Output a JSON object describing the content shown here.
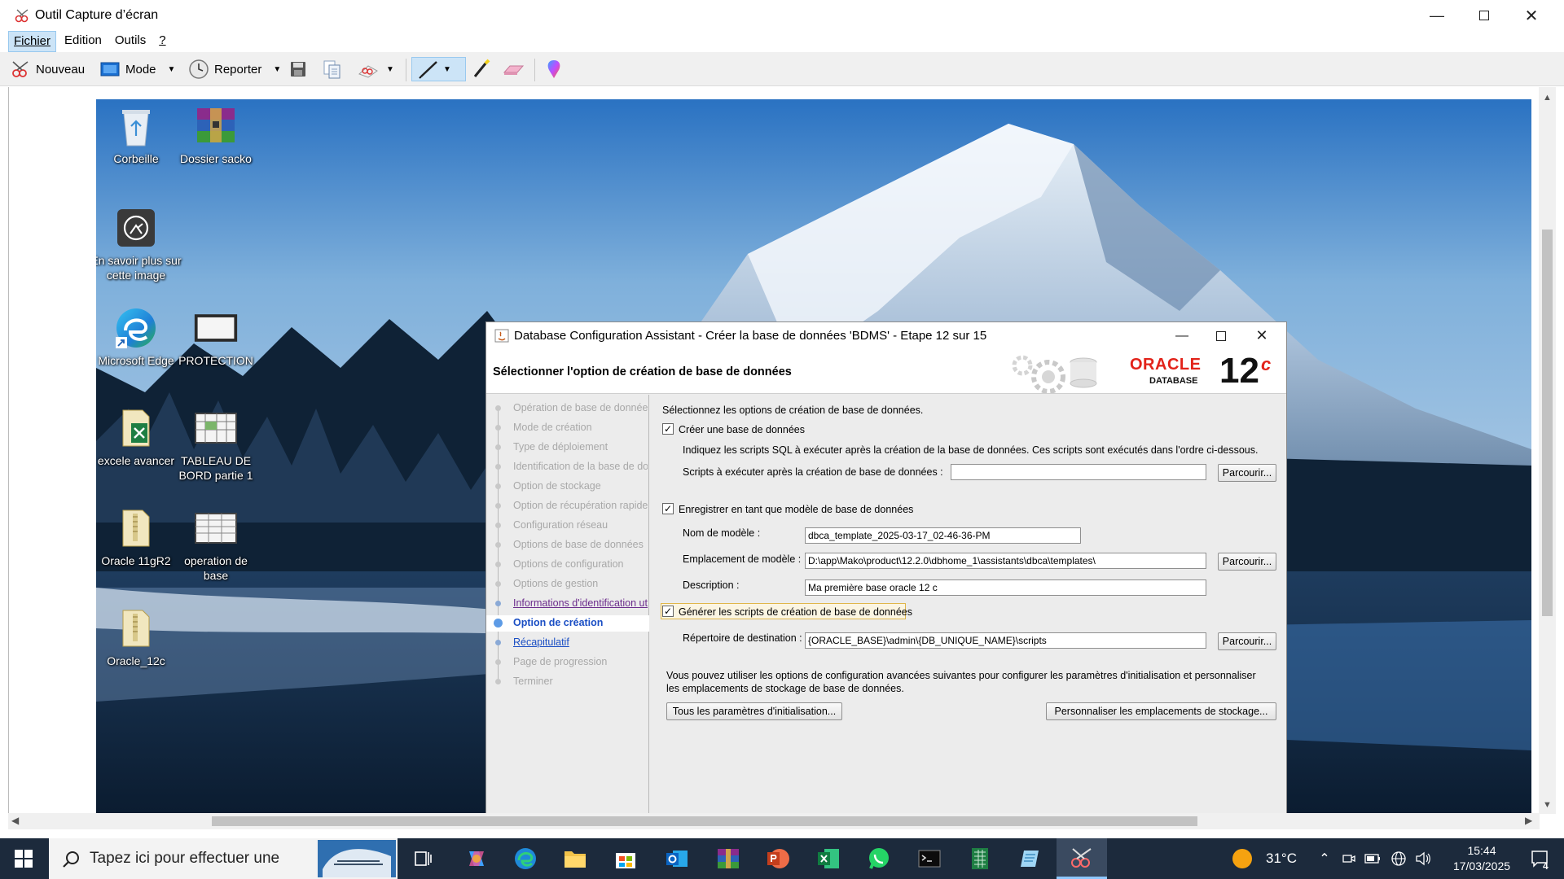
{
  "snip": {
    "title": "Outil Capture d’écran",
    "menu": [
      "Fichier",
      "Edition",
      "Outils",
      "?"
    ],
    "toolbar": {
      "new_label": "Nouveau",
      "mode_label": "Mode",
      "delay_label": "Reporter"
    }
  },
  "desktop": {
    "icons": [
      {
        "label": "Corbeille",
        "icon": "recycle-bin-icon"
      },
      {
        "label": "Dossier sacko",
        "icon": "winrar-icon"
      },
      {
        "label": "En savoir plus sur cette image",
        "icon": "spotlight-icon"
      },
      {
        "label": "Microsoft Edge",
        "icon": "edge-icon"
      },
      {
        "label": "PROTECTION",
        "icon": "shortcut-icon"
      },
      {
        "label": "excele avancer",
        "icon": "excel-file-icon"
      },
      {
        "label": "TABLEAU DE BORD partie 1",
        "icon": "excel-file-icon"
      },
      {
        "label": "Oracle 11gR2",
        "icon": "zip-folder-icon"
      },
      {
        "label": "operation de base",
        "icon": "excel-file-icon"
      },
      {
        "label": "Oracle_12c",
        "icon": "zip-folder-icon"
      }
    ]
  },
  "dbca": {
    "title": "Database Configuration Assistant - Créer la base de données 'BDMS' - Etape 12 sur 15",
    "heading": "Sélectionner l'option de création de base de données",
    "logo": {
      "brand": "ORACLE",
      "sub": "DATABASE",
      "version": "12",
      "suffix": "c"
    },
    "steps": [
      {
        "label": "Opération de base de données",
        "state": "disabled"
      },
      {
        "label": "Mode de création",
        "state": "disabled"
      },
      {
        "label": "Type de déploiement",
        "state": "disabled"
      },
      {
        "label": "Identification de la base de données",
        "state": "disabled"
      },
      {
        "label": "Option de stockage",
        "state": "disabled"
      },
      {
        "label": "Option de récupération rapide",
        "state": "disabled"
      },
      {
        "label": "Configuration réseau",
        "state": "disabled"
      },
      {
        "label": "Options de base de données",
        "state": "disabled"
      },
      {
        "label": "Options de configuration",
        "state": "disabled"
      },
      {
        "label": "Options de gestion",
        "state": "disabled"
      },
      {
        "label": "Informations d'identification utilisateur",
        "state": "visited"
      },
      {
        "label": "Option de création",
        "state": "current"
      },
      {
        "label": "Récapitulatif",
        "state": "link"
      },
      {
        "label": "Page de progression",
        "state": "disabled"
      },
      {
        "label": "Terminer",
        "state": "disabled"
      }
    ],
    "intro": "Sélectionnez les options de création de base de données.",
    "create_db": {
      "label": "Créer une base de données",
      "checked": true
    },
    "scripts_info": "Indiquez les scripts SQL à exécuter après la création de la base de données. Ces scripts sont exécutés dans l'ordre ci-dessous.",
    "scripts_label": "Scripts à exécuter après la création de base de données :",
    "scripts_value": "",
    "browse_label": "Parcourir...",
    "save_template": {
      "label": "Enregistrer en tant que modèle de base de données",
      "checked": true
    },
    "template_name_label": "Nom de modèle :",
    "template_name_value": "dbca_template_2025-03-17_02-46-36-PM",
    "template_location_label": "Emplacement de modèle :",
    "template_location_value": "D:\\app\\Mako\\product\\12.2.0\\dbhome_1\\assistants\\dbca\\templates\\",
    "description_label": "Description :",
    "description_value": "Ma première base oracle 12 c",
    "gen_scripts": {
      "label": "Générer les scripts de création de base de données",
      "checked": true
    },
    "dest_dir_label": "Répertoire de destination :",
    "dest_dir_value": "{ORACLE_BASE}\\admin\\{DB_UNIQUE_NAME}\\scripts",
    "advanced_info_1": "Vous pouvez utiliser les options de configuration avancées suivantes pour configurer les paramètres d'initialisation et personnaliser",
    "advanced_info_2": "les emplacements de stockage de base de données.",
    "init_params_button": "Tous les paramètres d'initialisation...",
    "storage_button": "Personnaliser les emplacements de stockage..."
  },
  "taskbar": {
    "search_placeholder": "Tapez ici pour effectuer une",
    "weather": "31°C",
    "time": "15:44",
    "date": "17/03/2025",
    "notification_count": "4"
  },
  "colors": {
    "oracle_red": "#e2231a",
    "link_blue": "#1a4ec4",
    "visited_purple": "#6b2c8c",
    "taskbar": "#1c2a3c"
  }
}
